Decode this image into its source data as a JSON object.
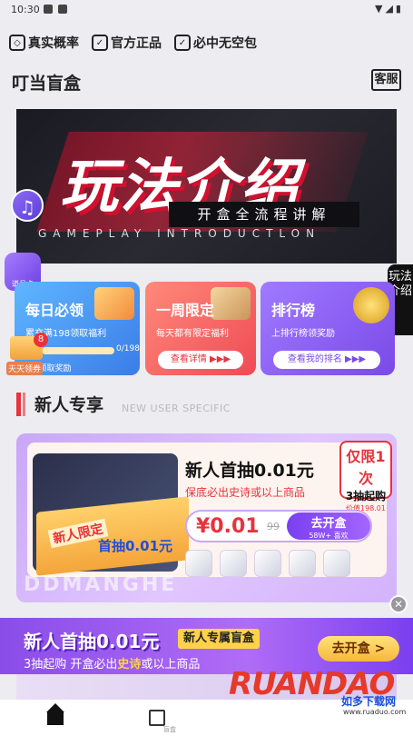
{
  "status_bar": {
    "time": "10:30",
    "right_icons": "▼◢▮"
  },
  "features": [
    {
      "icon": "cube-icon",
      "label": "真实概率"
    },
    {
      "icon": "shield-icon",
      "label": "官方正品"
    },
    {
      "icon": "check-icon",
      "label": "必中无空包"
    }
  ],
  "header": {
    "brand": "叮当盲盒",
    "service_label": "客服"
  },
  "banner": {
    "title": "玩法介绍",
    "subtitle": "开盒全流程讲解",
    "english": "GAMEPLAY INTRODUCTLON"
  },
  "floating": {
    "music_icon": "music-note-icon",
    "coupon_label": "道具卡",
    "signin_badge": "8",
    "signin_label": "天天领券"
  },
  "side_tab": {
    "label": "玩法介绍"
  },
  "cards": {
    "daily": {
      "title": "每日必领",
      "subtitle": "累充满198领取福利",
      "progress_text": "0/198",
      "progress": 0,
      "reward": "98元领取奖励"
    },
    "limited": {
      "title": "一周限定",
      "subtitle": "每天都有限定福利",
      "button": "查看详情 ▶▶▶"
    },
    "rank": {
      "title": "排行榜",
      "subtitle": "上排行榜领奖励",
      "button": "查看我的排名 ▶▶▶"
    }
  },
  "section": {
    "title": "新人专享",
    "english": "NEW USER SPECIFIC"
  },
  "promo": {
    "gift_tag": "新人限定",
    "gift_line": "首抽0.01元",
    "title": "新人首抽0.01元",
    "subtitle": "保底必出史诗或以上商品",
    "badge_line1": "仅限1次",
    "badge_line2": "3抽起购",
    "badge_line3": "价值198.01",
    "price": "¥0.01",
    "price_old": "99",
    "go_button": "去开盒",
    "go_meta": "58W+ 喜欢",
    "watermark": "DDMANGHE"
  },
  "close_icon": "✕",
  "bottom_banner": {
    "title": "新人首抽0.01元",
    "pill": "新人专属盲盒",
    "subtitle_before": "3抽起购  开盒必出",
    "subtitle_highlight": "史诗",
    "subtitle_after": "或以上商品",
    "button": "去开盒 >"
  },
  "logo": {
    "text": "RUANDAO",
    "cn": "如多下载网",
    "url": "www.ruaduo.com"
  },
  "tabbar": {
    "home_icon": "home-icon",
    "box_icon": "box-icon",
    "box_label": "盲盒"
  },
  "colors": {
    "accent_red": "#e8323c",
    "accent_purple": "#8a4de8",
    "gold": "#ffd24a"
  }
}
